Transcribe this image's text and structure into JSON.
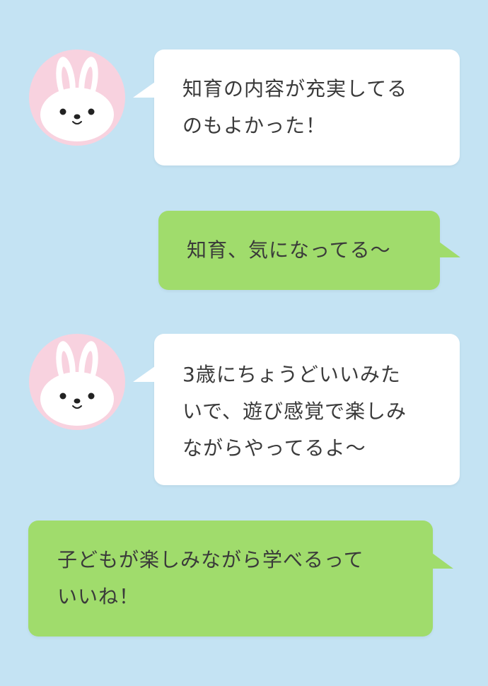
{
  "theme": {
    "background": "#c4e3f3",
    "bubble_white": "#ffffff",
    "bubble_green": "#a0dc6c",
    "avatar_background": "#f8d2df",
    "text_color": "#3a3a3a"
  },
  "conversation": {
    "messages": [
      {
        "sender": "other",
        "avatar": "bunny-icon",
        "lines": [
          "知育の内容が充実してる",
          "のもよかった！"
        ]
      },
      {
        "sender": "self",
        "lines": [
          "知育、気になってる〜"
        ]
      },
      {
        "sender": "other",
        "avatar": "bunny-icon",
        "lines": [
          "3歳にちょうどいいみた",
          "いで、遊び感覚で楽しみ",
          "ながらやってるよ〜"
        ]
      },
      {
        "sender": "self",
        "lines": [
          "子どもが楽しみながら学べるって",
          "いいね！"
        ]
      }
    ]
  }
}
